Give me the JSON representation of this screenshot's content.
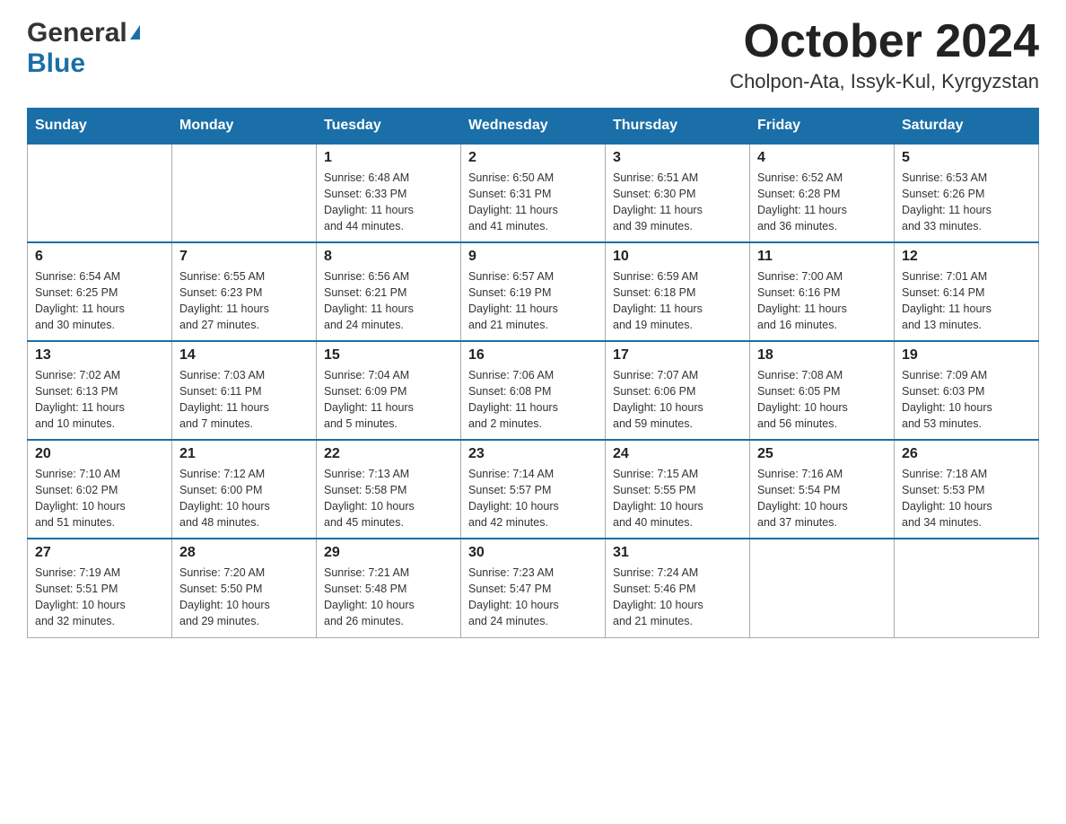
{
  "logo": {
    "general": "General",
    "triangle": "▶",
    "blue": "Blue"
  },
  "title": {
    "month": "October 2024",
    "location": "Cholpon-Ata, Issyk-Kul, Kyrgyzstan"
  },
  "header": {
    "days": [
      "Sunday",
      "Monday",
      "Tuesday",
      "Wednesday",
      "Thursday",
      "Friday",
      "Saturday"
    ]
  },
  "weeks": [
    {
      "cells": [
        {
          "day": "",
          "info": ""
        },
        {
          "day": "",
          "info": ""
        },
        {
          "day": "1",
          "info": "Sunrise: 6:48 AM\nSunset: 6:33 PM\nDaylight: 11 hours\nand 44 minutes."
        },
        {
          "day": "2",
          "info": "Sunrise: 6:50 AM\nSunset: 6:31 PM\nDaylight: 11 hours\nand 41 minutes."
        },
        {
          "day": "3",
          "info": "Sunrise: 6:51 AM\nSunset: 6:30 PM\nDaylight: 11 hours\nand 39 minutes."
        },
        {
          "day": "4",
          "info": "Sunrise: 6:52 AM\nSunset: 6:28 PM\nDaylight: 11 hours\nand 36 minutes."
        },
        {
          "day": "5",
          "info": "Sunrise: 6:53 AM\nSunset: 6:26 PM\nDaylight: 11 hours\nand 33 minutes."
        }
      ]
    },
    {
      "cells": [
        {
          "day": "6",
          "info": "Sunrise: 6:54 AM\nSunset: 6:25 PM\nDaylight: 11 hours\nand 30 minutes."
        },
        {
          "day": "7",
          "info": "Sunrise: 6:55 AM\nSunset: 6:23 PM\nDaylight: 11 hours\nand 27 minutes."
        },
        {
          "day": "8",
          "info": "Sunrise: 6:56 AM\nSunset: 6:21 PM\nDaylight: 11 hours\nand 24 minutes."
        },
        {
          "day": "9",
          "info": "Sunrise: 6:57 AM\nSunset: 6:19 PM\nDaylight: 11 hours\nand 21 minutes."
        },
        {
          "day": "10",
          "info": "Sunrise: 6:59 AM\nSunset: 6:18 PM\nDaylight: 11 hours\nand 19 minutes."
        },
        {
          "day": "11",
          "info": "Sunrise: 7:00 AM\nSunset: 6:16 PM\nDaylight: 11 hours\nand 16 minutes."
        },
        {
          "day": "12",
          "info": "Sunrise: 7:01 AM\nSunset: 6:14 PM\nDaylight: 11 hours\nand 13 minutes."
        }
      ]
    },
    {
      "cells": [
        {
          "day": "13",
          "info": "Sunrise: 7:02 AM\nSunset: 6:13 PM\nDaylight: 11 hours\nand 10 minutes."
        },
        {
          "day": "14",
          "info": "Sunrise: 7:03 AM\nSunset: 6:11 PM\nDaylight: 11 hours\nand 7 minutes."
        },
        {
          "day": "15",
          "info": "Sunrise: 7:04 AM\nSunset: 6:09 PM\nDaylight: 11 hours\nand 5 minutes."
        },
        {
          "day": "16",
          "info": "Sunrise: 7:06 AM\nSunset: 6:08 PM\nDaylight: 11 hours\nand 2 minutes."
        },
        {
          "day": "17",
          "info": "Sunrise: 7:07 AM\nSunset: 6:06 PM\nDaylight: 10 hours\nand 59 minutes."
        },
        {
          "day": "18",
          "info": "Sunrise: 7:08 AM\nSunset: 6:05 PM\nDaylight: 10 hours\nand 56 minutes."
        },
        {
          "day": "19",
          "info": "Sunrise: 7:09 AM\nSunset: 6:03 PM\nDaylight: 10 hours\nand 53 minutes."
        }
      ]
    },
    {
      "cells": [
        {
          "day": "20",
          "info": "Sunrise: 7:10 AM\nSunset: 6:02 PM\nDaylight: 10 hours\nand 51 minutes."
        },
        {
          "day": "21",
          "info": "Sunrise: 7:12 AM\nSunset: 6:00 PM\nDaylight: 10 hours\nand 48 minutes."
        },
        {
          "day": "22",
          "info": "Sunrise: 7:13 AM\nSunset: 5:58 PM\nDaylight: 10 hours\nand 45 minutes."
        },
        {
          "day": "23",
          "info": "Sunrise: 7:14 AM\nSunset: 5:57 PM\nDaylight: 10 hours\nand 42 minutes."
        },
        {
          "day": "24",
          "info": "Sunrise: 7:15 AM\nSunset: 5:55 PM\nDaylight: 10 hours\nand 40 minutes."
        },
        {
          "day": "25",
          "info": "Sunrise: 7:16 AM\nSunset: 5:54 PM\nDaylight: 10 hours\nand 37 minutes."
        },
        {
          "day": "26",
          "info": "Sunrise: 7:18 AM\nSunset: 5:53 PM\nDaylight: 10 hours\nand 34 minutes."
        }
      ]
    },
    {
      "cells": [
        {
          "day": "27",
          "info": "Sunrise: 7:19 AM\nSunset: 5:51 PM\nDaylight: 10 hours\nand 32 minutes."
        },
        {
          "day": "28",
          "info": "Sunrise: 7:20 AM\nSunset: 5:50 PM\nDaylight: 10 hours\nand 29 minutes."
        },
        {
          "day": "29",
          "info": "Sunrise: 7:21 AM\nSunset: 5:48 PM\nDaylight: 10 hours\nand 26 minutes."
        },
        {
          "day": "30",
          "info": "Sunrise: 7:23 AM\nSunset: 5:47 PM\nDaylight: 10 hours\nand 24 minutes."
        },
        {
          "day": "31",
          "info": "Sunrise: 7:24 AM\nSunset: 5:46 PM\nDaylight: 10 hours\nand 21 minutes."
        },
        {
          "day": "",
          "info": ""
        },
        {
          "day": "",
          "info": ""
        }
      ]
    }
  ],
  "colors": {
    "header_bg": "#1a6fa8",
    "header_text": "#ffffff",
    "border": "#aaaaaa",
    "week_border": "#1a6fa8"
  }
}
